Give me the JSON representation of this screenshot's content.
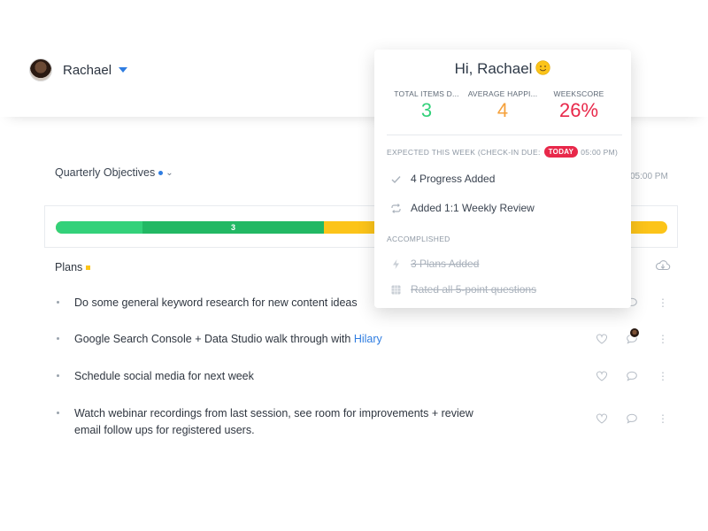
{
  "header": {
    "user_name": "Rachael"
  },
  "objectives": {
    "title": "Quarterly Objectives",
    "time_peek": "05:00 PM",
    "progress": {
      "segment_label": "3",
      "green_fraction": 0.438,
      "dark_segment_start_fraction": 0.142,
      "colors": {
        "green": "#33d17a",
        "dark_green": "#22b864",
        "yellow": "#fcc419"
      }
    }
  },
  "plans": {
    "title": "Plans",
    "items": [
      {
        "text": "Do some general keyword research for new content ideas",
        "link": ""
      },
      {
        "text": "Google Search Console + Data Studio walk through with ",
        "link": "Hilary"
      },
      {
        "text": "Schedule social media for next week",
        "link": ""
      },
      {
        "text": "Watch webinar recordings from last session, see room for improvements + review email follow ups for registered users.",
        "link": ""
      }
    ]
  },
  "popover": {
    "greeting": "Hi, Rachael",
    "stats": [
      {
        "label": "TOTAL ITEMS D...",
        "value": "3",
        "color": "#33d17a"
      },
      {
        "label": "AVERAGE HAPPI...",
        "value": "4",
        "color": "#f5a03a"
      },
      {
        "label": "WEEKSCORE",
        "value": "26%",
        "color": "#e8284a"
      }
    ],
    "expected": {
      "label": "EXPECTED THIS WEEK (CHECK-IN DUE:",
      "badge": "TODAY",
      "time": "05:00 PM)",
      "tasks": [
        "4 Progress Added",
        "Added 1:1 Weekly Review"
      ]
    },
    "accomplished": {
      "label": "ACCOMPLISHED",
      "tasks": [
        "3 Plans Added",
        "Rated all 5-point questions"
      ]
    }
  },
  "icons": {
    "user_caret": "caret-down-icon",
    "objectives_chevron": "chevron-down-icon",
    "export": "cloud-download-icon",
    "like": "heart-icon",
    "comment": "comment-icon",
    "more": "more-vertical-icon",
    "greeting": "smiley-icon",
    "check": "check-icon",
    "repeat": "repeat-icon",
    "progress": "bolt-icon",
    "rating": "grid-icon"
  }
}
